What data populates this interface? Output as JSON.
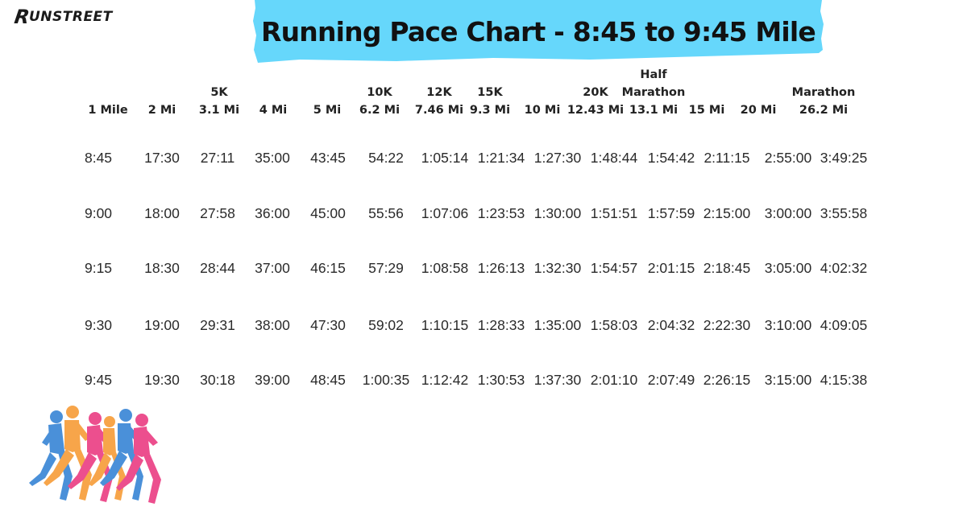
{
  "brand": {
    "logo_text": "UNSTREET",
    "logo_mark": "R"
  },
  "title": "Running Pace Chart - 8:45 to 9:45 Mile",
  "colors": {
    "banner": "#66d7fb",
    "runner_blue": "#4a90d9",
    "runner_orange": "#f7a54a",
    "runner_pink": "#ec4f8e"
  },
  "columns": [
    {
      "lines": [
        "1 Mile"
      ]
    },
    {
      "lines": [
        "2 Mi"
      ]
    },
    {
      "lines": [
        "5K",
        "3.1 Mi"
      ]
    },
    {
      "lines": [
        "4 Mi"
      ]
    },
    {
      "lines": [
        "5 Mi"
      ]
    },
    {
      "lines": [
        "10K",
        "6.2 Mi"
      ]
    },
    {
      "lines": [
        "12K",
        "7.46 Mi"
      ]
    },
    {
      "lines": [
        "15K",
        "9.3 Mi"
      ]
    },
    {
      "lines": [
        "10 Mi"
      ]
    },
    {
      "lines": [
        "20K",
        "12.43 Mi"
      ]
    },
    {
      "lines": [
        "Half",
        "Marathon",
        "13.1 Mi"
      ]
    },
    {
      "lines": [
        "15 Mi"
      ]
    },
    {
      "lines": [
        "20 Mi"
      ]
    },
    {
      "lines": [
        "Marathon",
        "26.2 Mi"
      ]
    }
  ],
  "rows": [
    [
      "8:45",
      "17:30",
      "27:11",
      "35:00",
      "43:45",
      "54:22",
      "1:05:14",
      "1:21:34",
      "1:27:30",
      "1:48:44",
      "1:54:42",
      "2:11:15",
      "2:55:00",
      "3:49:25"
    ],
    [
      "9:00",
      "18:00",
      "27:58",
      "36:00",
      "45:00",
      "55:56",
      "1:07:06",
      "1:23:53",
      "1:30:00",
      "1:51:51",
      "1:57:59",
      "2:15:00",
      "3:00:00",
      "3:55:58"
    ],
    [
      "9:15",
      "18:30",
      "28:44",
      "37:00",
      "46:15",
      "57:29",
      "1:08:58",
      "1:26:13",
      "1:32:30",
      "1:54:57",
      "2:01:15",
      "2:18:45",
      "3:05:00",
      "4:02:32"
    ],
    [
      "9:30",
      "19:00",
      "29:31",
      "38:00",
      "47:30",
      "59:02",
      "1:10:15",
      "1:28:33",
      "1:35:00",
      "1:58:03",
      "2:04:32",
      "2:22:30",
      "3:10:00",
      "4:09:05"
    ],
    [
      "9:45",
      "19:30",
      "30:18",
      "39:00",
      "48:45",
      "1:00:35",
      "1:12:42",
      "1:30:53",
      "1:37:30",
      "2:01:10",
      "2:07:49",
      "2:26:15",
      "3:15:00",
      "4:15:38"
    ]
  ],
  "illustration": {
    "icon": "runners-group-icon"
  }
}
